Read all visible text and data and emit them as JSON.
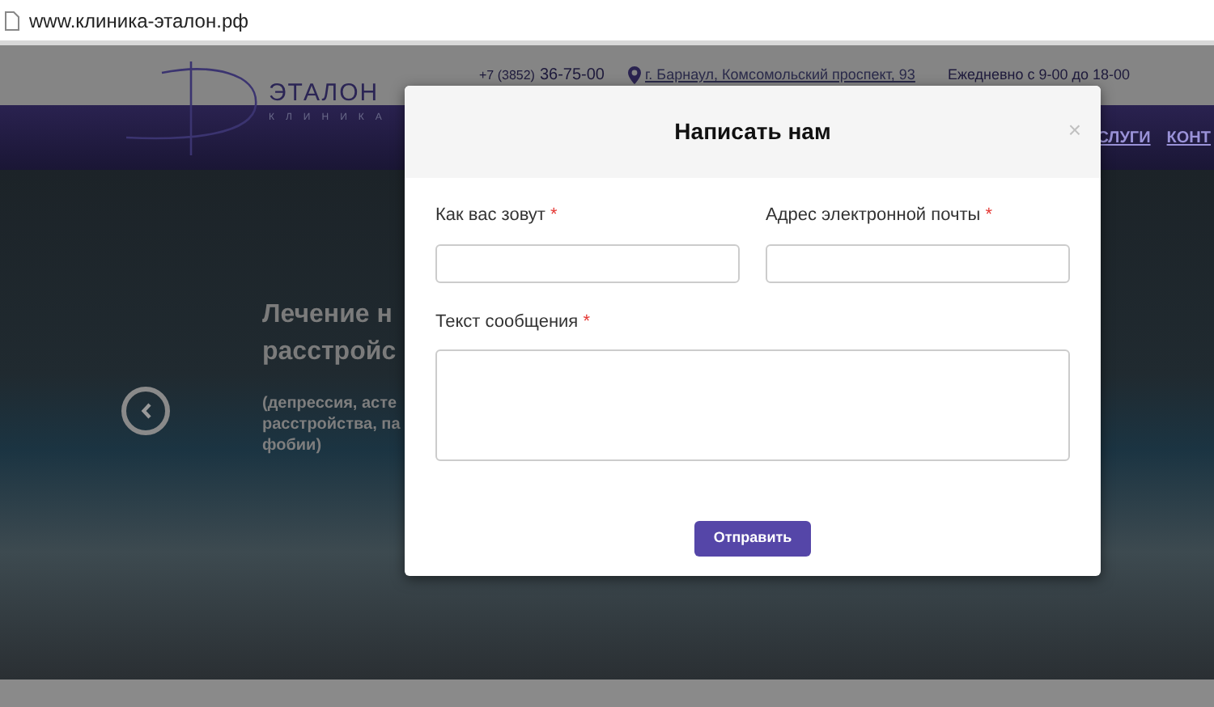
{
  "browser": {
    "url": "www.клиника-эталон.рф"
  },
  "site_header": {
    "logo": {
      "name": "ЭТАЛОН",
      "subtitle": "КЛИНИКА"
    },
    "phone_code": "+7 (3852)",
    "phone": "36-75-00",
    "address": "г. Барнаул, Комсомольский проспект, 93",
    "hours": "Ежедневно с 9-00 до 18-00"
  },
  "nav": {
    "items": [
      "СЛУГИ",
      "КОНТ"
    ]
  },
  "hero": {
    "title_lines": [
      "Лечение н",
      "расстройс"
    ],
    "subtitle_lines": [
      "(депрессия, асте",
      "расстройства, па",
      "фобии)"
    ]
  },
  "modal": {
    "title": "Написать нам",
    "close": "×",
    "fields": [
      {
        "label": "Как вас зовут",
        "required_mark": "*",
        "kind": "input"
      },
      {
        "label": "Адрес электронной почты",
        "required_mark": "*",
        "kind": "input"
      },
      {
        "label": "Текст сообщения",
        "required_mark": "*",
        "kind": "textarea"
      }
    ],
    "submit": "Отправить"
  }
}
